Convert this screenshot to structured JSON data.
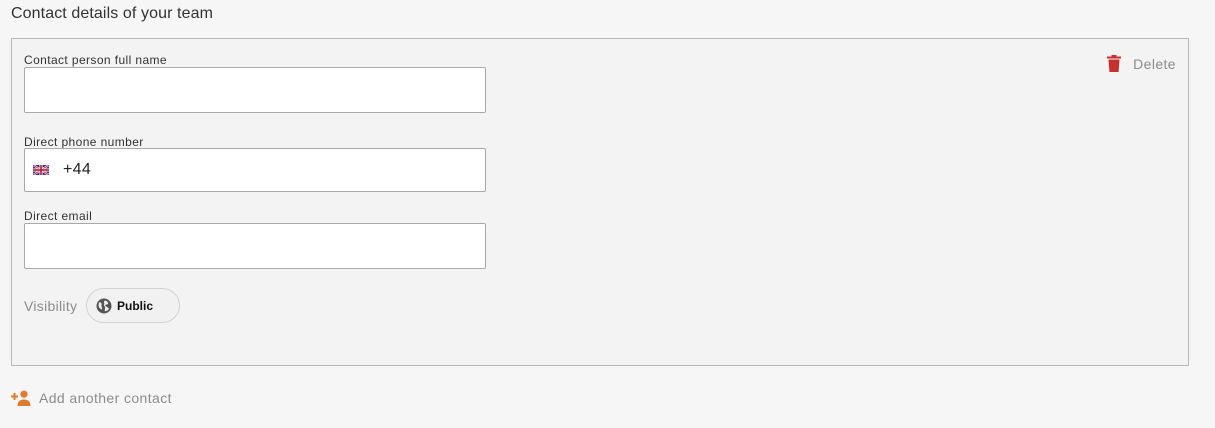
{
  "section": {
    "title": "Contact details of your team"
  },
  "contact_card": {
    "delete_label": "Delete",
    "fields": {
      "full_name": {
        "label": "Contact person full name",
        "value": ""
      },
      "phone": {
        "label": "Direct phone number",
        "country_flag": "uk-flag-icon",
        "dial_code": "+44"
      },
      "email": {
        "label": "Direct email",
        "value": ""
      }
    },
    "visibility": {
      "label": "Visibility",
      "value": "Public",
      "icon": "globe-icon"
    }
  },
  "add_contact": {
    "label": "Add another contact",
    "icon": "add-person-icon"
  },
  "colors": {
    "delete_icon": "#c9302c",
    "add_icon": "#e07a2e",
    "muted_text": "#8c8c8c"
  }
}
